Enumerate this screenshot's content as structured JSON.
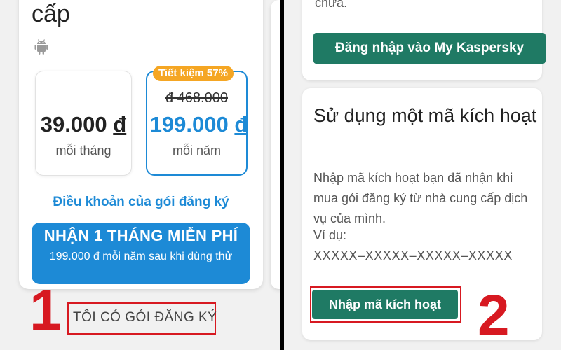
{
  "left_panel": {
    "title_fragment": "cấp",
    "platform_icon": "android-icon",
    "monthly": {
      "price": "39.000",
      "currency": "đ",
      "period": "mỗi tháng"
    },
    "yearly": {
      "badge": "Tiết kiệm 57%",
      "old_price": "đ 468.000",
      "price": "199.000",
      "currency": "đ",
      "period": "mỗi năm"
    },
    "terms_link": "Điều khoản của gói đăng ký",
    "trial_button": {
      "main": "NHẬN 1 THÁNG MIỄN PHÍ",
      "sub": "199.000 đ mỗi năm sau khi dùng thử"
    },
    "have_plan_button": "TÔI CÓ GÓI ĐĂNG KÝ",
    "step_number": "1"
  },
  "right_panel": {
    "truncated_text": "chưa.",
    "login_button": "Đăng nhập vào My Kaspersky",
    "code_section": {
      "title": "Sử dụng một mã kích hoạt",
      "description": "Nhập mã kích hoạt bạn đã nhận khi mua gói đăng ký từ nhà cung cấp dịch vụ của mình.",
      "example_label": "Ví dụ:",
      "example_code": "XXXXX–XXXXX–XXXXX–XXXXX",
      "activate_button": "Nhập mã kích hoạt"
    },
    "step_number": "2"
  },
  "colors": {
    "primary_blue": "#1d8ad6",
    "kaspersky_green": "#1f7a64",
    "badge_orange": "#f5a623",
    "annotation_red": "#d71921"
  }
}
